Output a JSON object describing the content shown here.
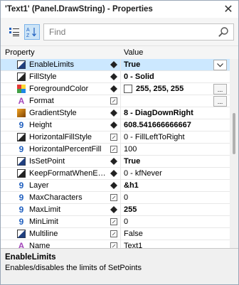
{
  "window": {
    "title": "'Text1' (Panel.DrawString) - Properties",
    "close_glyph": "✕"
  },
  "search": {
    "placeholder": "Find"
  },
  "columns": {
    "property": "Property",
    "value": "Value"
  },
  "properties": [
    {
      "name": "EnableLimits",
      "value": "True",
      "icon": "enable-limits-icon",
      "mark": "diamond",
      "bold": true,
      "selected": true,
      "control": "dropdown"
    },
    {
      "name": "FillStyle",
      "value": "0 - Solid",
      "icon": "fill-style-icon",
      "mark": "diamond",
      "bold": true
    },
    {
      "name": "ForegroundColor",
      "value": "255, 255, 255",
      "icon": "palette-icon",
      "mark": "diamond",
      "bold": true,
      "swatch": "#ffffff",
      "control": "ellipsis"
    },
    {
      "name": "Format",
      "value": "",
      "icon": "font-icon",
      "mark": "pencil",
      "bold": false,
      "control": "ellipsis"
    },
    {
      "name": "GradientStyle",
      "value": "8 - DiagDownRight",
      "icon": "gradient-icon",
      "mark": "diamond",
      "bold": true
    },
    {
      "name": "Height",
      "value": "608.541666666667",
      "icon": "number-icon",
      "mark": "diamond",
      "bold": true
    },
    {
      "name": "HorizontalFillStyle",
      "value": "0 - FillLeftToRight",
      "icon": "fill-style-icon",
      "mark": "pencil",
      "bold": false
    },
    {
      "name": "HorizontalPercentFill",
      "value": "100",
      "icon": "number-icon",
      "mark": "pencil",
      "bold": false
    },
    {
      "name": "IsSetPoint",
      "value": "True",
      "icon": "enable-limits-icon",
      "mark": "diamond",
      "bold": true
    },
    {
      "name": "KeepFormatWhenE…",
      "value": "0 - kfNever",
      "icon": "fill-style-icon",
      "mark": "diamond",
      "bold": false
    },
    {
      "name": "Layer",
      "value": "&h1",
      "icon": "number-icon",
      "mark": "diamond",
      "bold": true
    },
    {
      "name": "MaxCharacters",
      "value": "0",
      "icon": "number-icon",
      "mark": "pencil",
      "bold": false
    },
    {
      "name": "MaxLimit",
      "value": "255",
      "icon": "number-icon",
      "mark": "diamond",
      "bold": true
    },
    {
      "name": "MinLimit",
      "value": "0",
      "icon": "number-icon",
      "mark": "pencil",
      "bold": false
    },
    {
      "name": "Multiline",
      "value": "False",
      "icon": "enable-limits-icon",
      "mark": "pencil",
      "bold": false
    },
    {
      "name": "Name",
      "value": "Text1",
      "icon": "font-icon",
      "mark": "pencil",
      "bold": false
    }
  ],
  "description": {
    "name": "EnableLimits",
    "text": "Enables/disables the limits of SetPoints"
  },
  "colors": {
    "selection": "#cce8ff",
    "font_icon": "#a347ba",
    "number_icon": "#1f5fbf"
  }
}
